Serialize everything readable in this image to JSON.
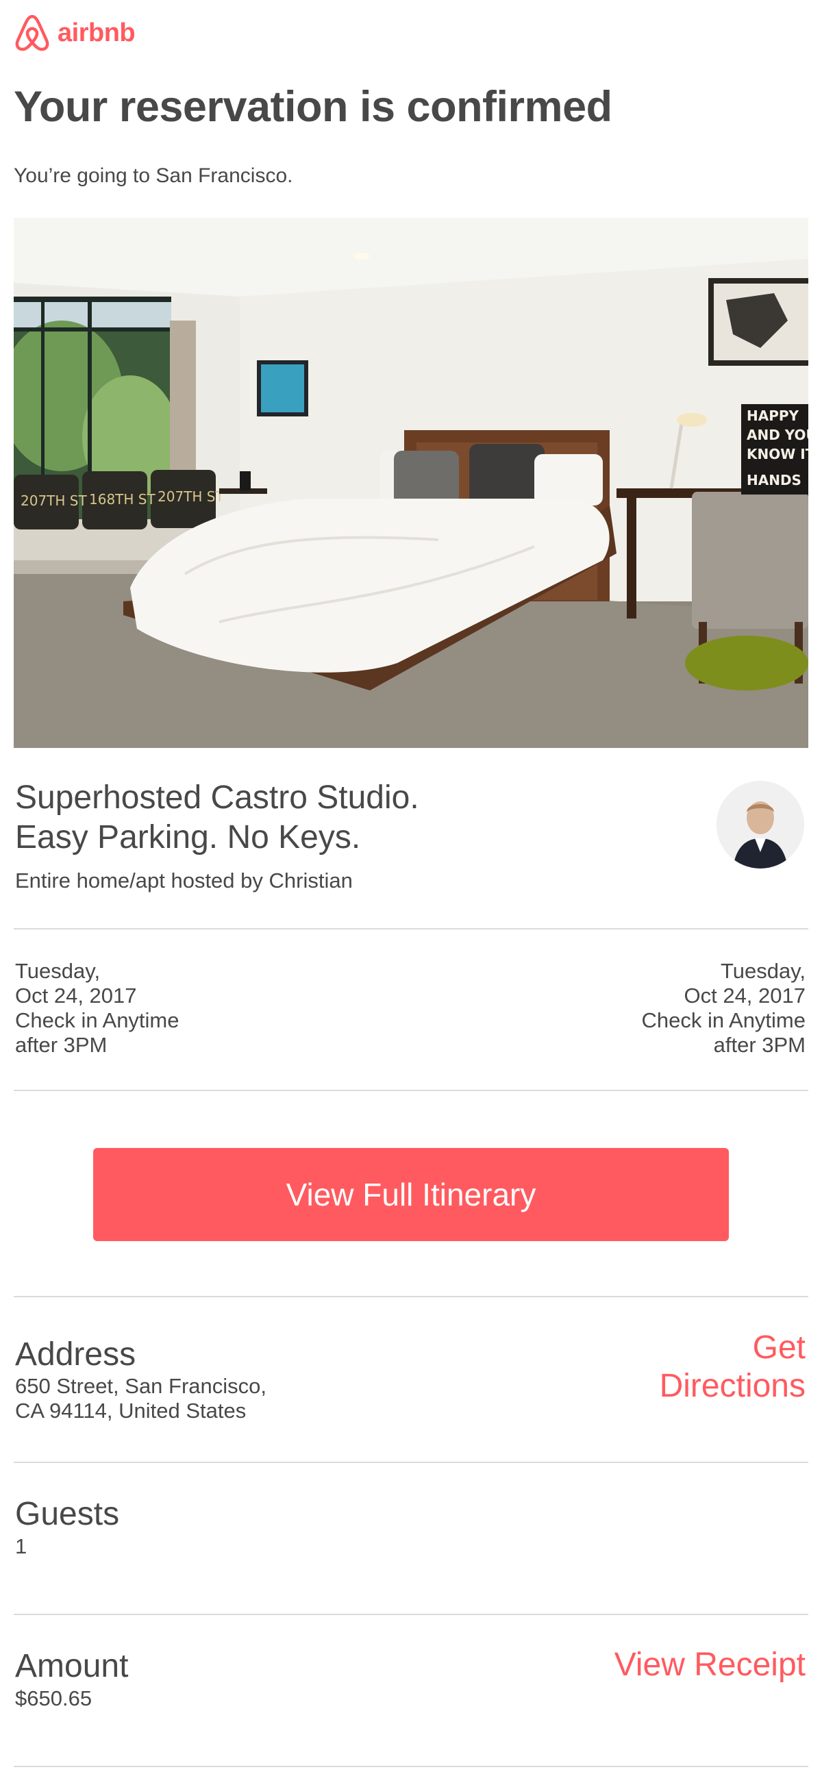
{
  "brand": {
    "name": "airbnb",
    "color": "#ff5a5f",
    "logo_icon": "airbnb-belo-icon"
  },
  "header": {
    "title": "Your reservation is confirmed",
    "subtitle": "You’re going to San Francisco."
  },
  "listing": {
    "photo": "bedroom-photo",
    "title_line1": "Superhosted Castro Studio.",
    "title_line2": "Easy Parking. No Keys.",
    "host_line": "Entire home/apt hosted by Christian",
    "host_avatar": "host-avatar"
  },
  "checkin": {
    "day": "Tuesday,",
    "date": "Oct 24, 2017",
    "label": "Check in Anytime",
    "time": "after 3PM"
  },
  "checkout": {
    "day": "Tuesday,",
    "date": "Oct 24, 2017",
    "label": "Check in Anytime",
    "time": "after 3PM"
  },
  "cta": {
    "label": "View Full Itinerary",
    "color": "#ff5a5f"
  },
  "address": {
    "label": "Address",
    "line1": "650 Street, San Francisco,",
    "line2": "CA 94114, United States",
    "link_line1": "Get",
    "link_line2": "Directions"
  },
  "guests": {
    "label": "Guests",
    "value": "1"
  },
  "amount": {
    "label": "Amount",
    "value": "$650.65",
    "link": "View Receipt"
  }
}
